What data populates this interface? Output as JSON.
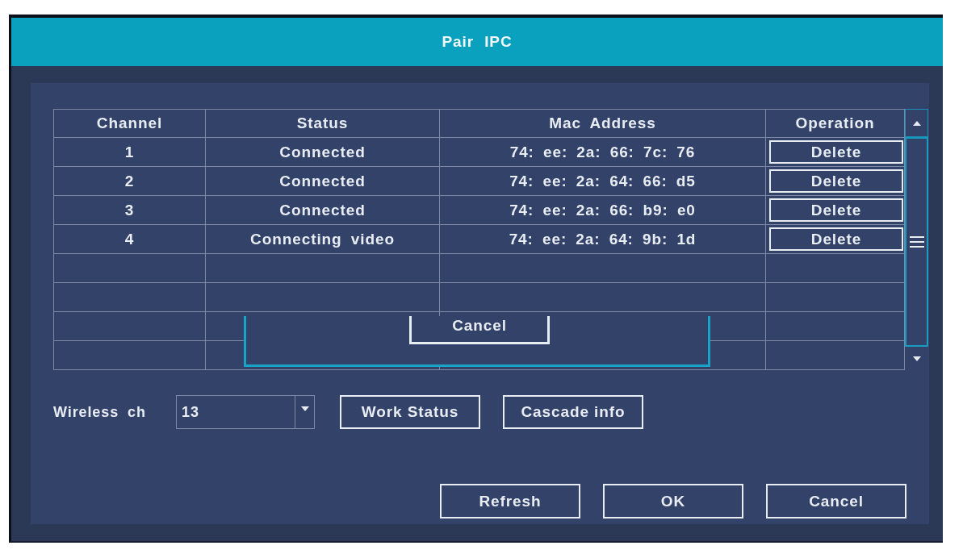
{
  "window": {
    "title": "Pair IPC"
  },
  "table": {
    "columns": [
      "Channel",
      "Status",
      "Mac Address",
      "Operation"
    ],
    "rows": [
      {
        "channel": "1",
        "status": "Connected",
        "mac_address": "74: ee: 2a: 66: 7c: 76",
        "operation": "Delete"
      },
      {
        "channel": "2",
        "status": "Connected",
        "mac_address": "74: ee: 2a: 64: 66: d5",
        "operation": "Delete"
      },
      {
        "channel": "3",
        "status": "Connected",
        "mac_address": "74: ee: 2a: 66: b9: e0",
        "operation": "Delete"
      },
      {
        "channel": "4",
        "status": "Connecting video",
        "mac_address": "74: ee: 2a: 64: 9b: 1d",
        "operation": "Delete"
      }
    ]
  },
  "overlay_dialog": {
    "buttons": [
      "Cancel"
    ]
  },
  "wireless_channel": {
    "label": "Wireless ch",
    "value": "13"
  },
  "tool_buttons": [
    "Work Status",
    "Cascade info"
  ],
  "footer_buttons": [
    "Refresh",
    "OK",
    "Cancel"
  ]
}
